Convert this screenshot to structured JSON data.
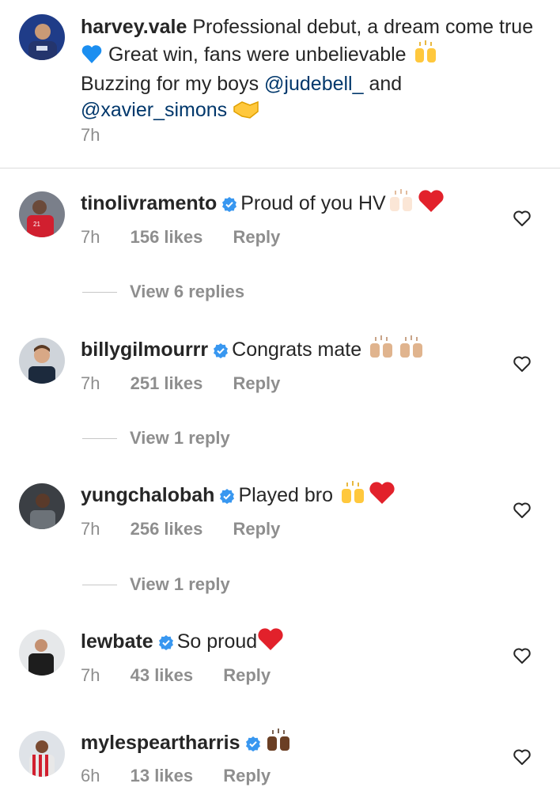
{
  "post": {
    "username": "harvey.vale",
    "caption_part1": "Professional debut, a dream come true",
    "caption_part2": "Great win, fans were unbelievable",
    "caption_part3": "Buzzing for my boys",
    "mention1": "@judebell_",
    "and_text": "and",
    "mention2": "@xavier_simons",
    "time": "7h"
  },
  "comments": [
    {
      "username": "tinolivramento",
      "text": "Proud of you HV",
      "time": "7h",
      "likes": "156 likes",
      "reply": "Reply",
      "view_replies": "View 6 replies"
    },
    {
      "username": "billygilmourrr",
      "text": "Congrats mate",
      "time": "7h",
      "likes": "251 likes",
      "reply": "Reply",
      "view_replies": "View 1 reply"
    },
    {
      "username": "yungchalobah",
      "text": "Played bro",
      "time": "7h",
      "likes": "256 likes",
      "reply": "Reply",
      "view_replies": "View 1 reply"
    },
    {
      "username": "lewbate",
      "text": "So proud",
      "time": "7h",
      "likes": "43 likes",
      "reply": "Reply"
    },
    {
      "username": "mylespeartharris",
      "text": "",
      "time": "6h",
      "likes": "13 likes",
      "reply": "Reply"
    }
  ],
  "colors": {
    "verified": "#3897f0",
    "heart_red": "#ed4956",
    "mention": "#00376b",
    "muted": "#8e8e8e"
  },
  "icons": [
    "verified-badge-icon",
    "heart-outline-icon",
    "blue-heart-emoji",
    "red-heart-emoji",
    "raised-hands-emoji",
    "handshake-emoji"
  ]
}
